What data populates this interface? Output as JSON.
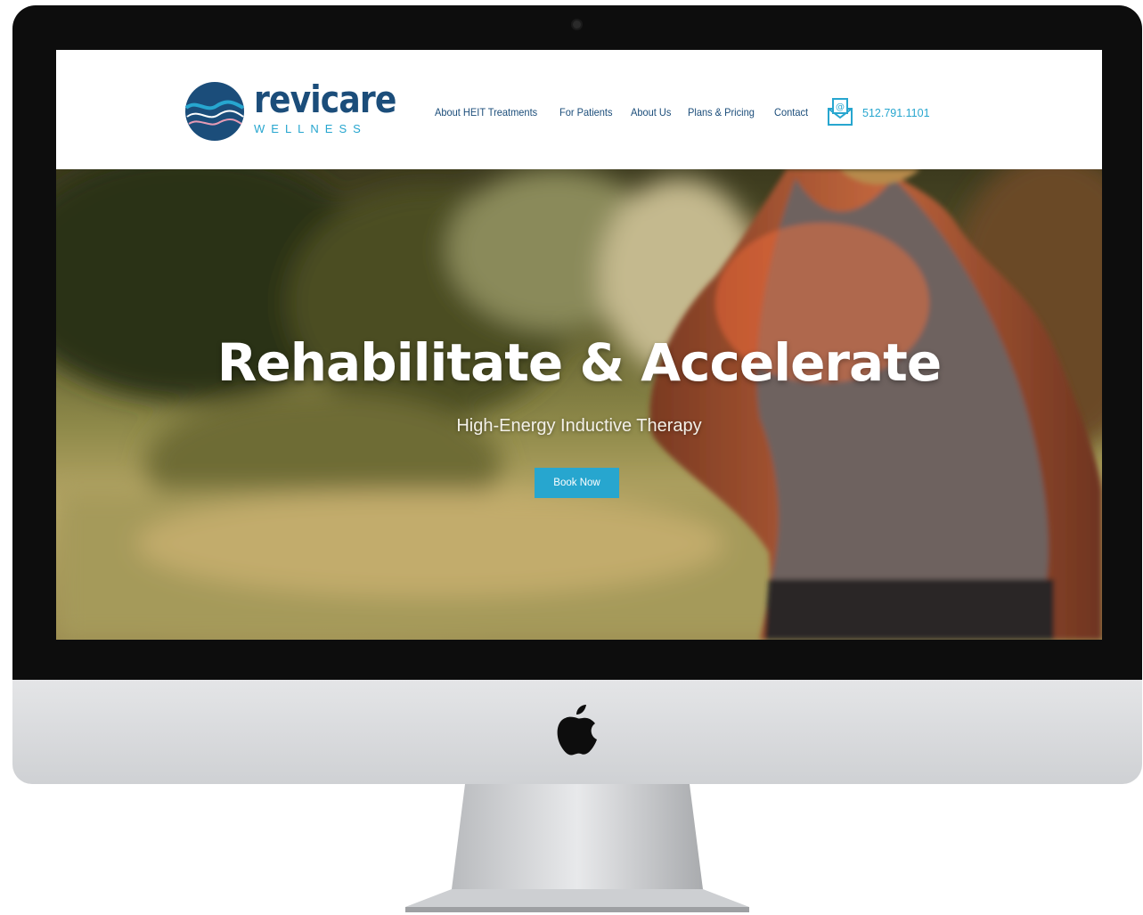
{
  "brand": {
    "name": "revicare",
    "tagline": "WELLNESS"
  },
  "nav": {
    "items": [
      {
        "label": "About HEIT Treatments"
      },
      {
        "label": "For Patients"
      },
      {
        "label": "About Us"
      },
      {
        "label": "Plans & Pricing"
      },
      {
        "label": "Contact"
      }
    ]
  },
  "contact": {
    "icon": "mail-icon",
    "phone": "512.791.1101"
  },
  "hero": {
    "title": "Rehabilitate & Accelerate",
    "subtitle": "High-Energy Inductive Therapy",
    "cta_label": "Book Now"
  },
  "colors": {
    "brand_navy": "#1b4d7a",
    "accent_blue": "#27a6cf",
    "bezel": "#0d0d0d",
    "chin": "#d9dadc"
  }
}
